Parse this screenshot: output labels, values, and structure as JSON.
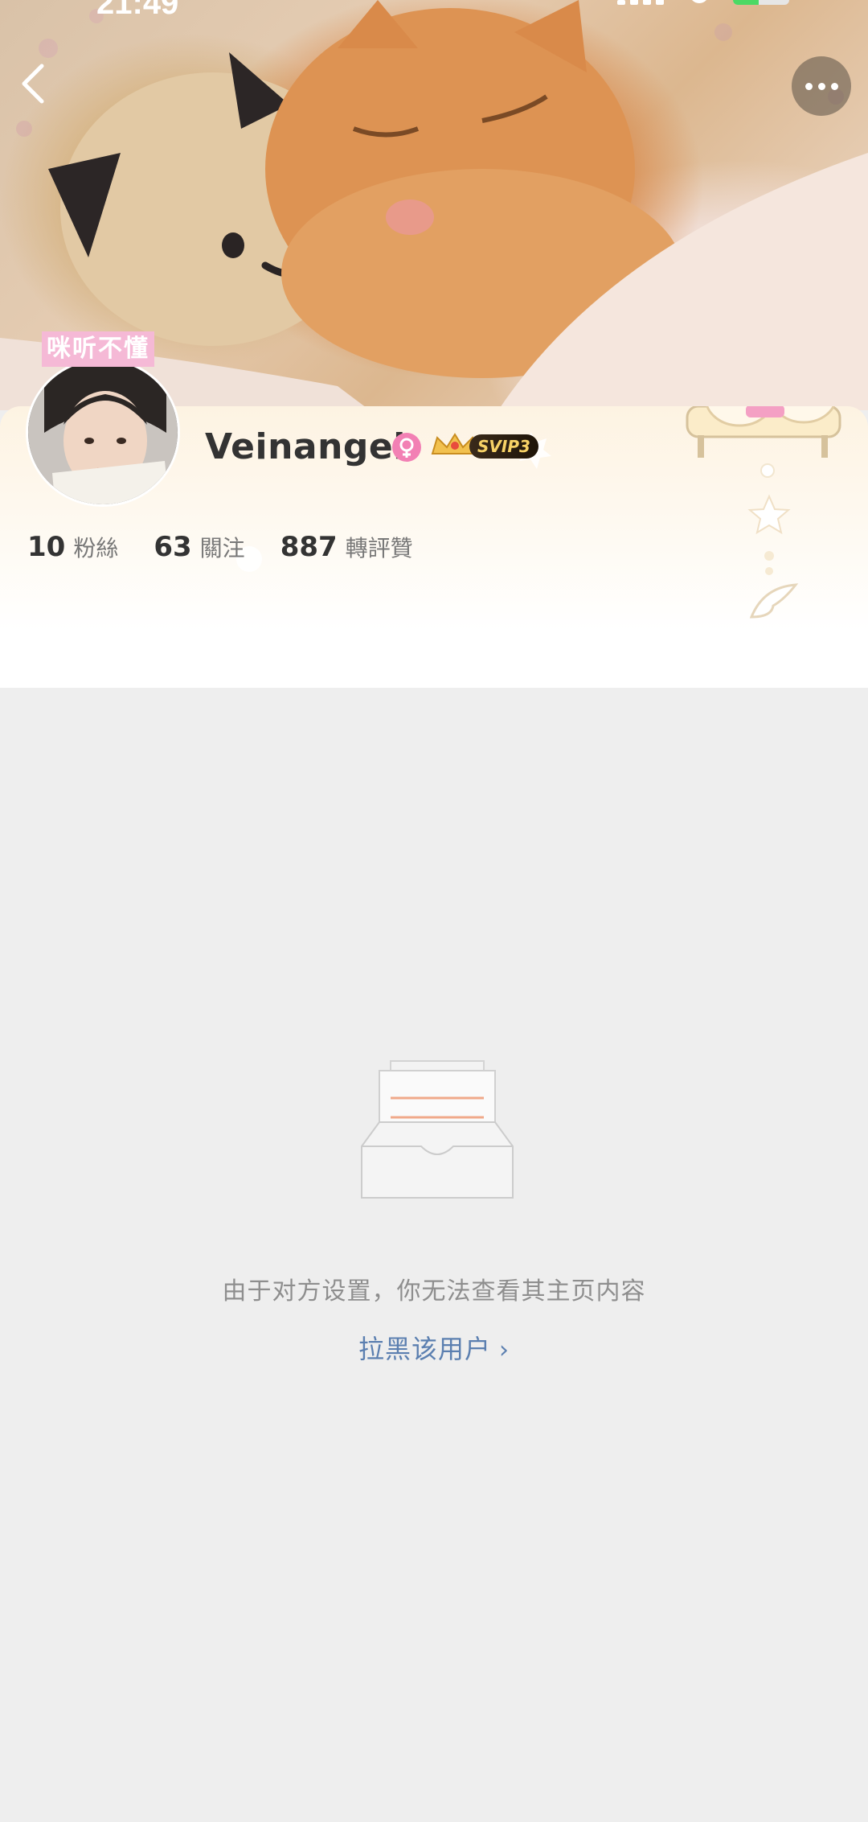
{
  "status_bar": {
    "time": "21:49",
    "battery_level": 0.46
  },
  "header": {
    "back_icon": "chevron-left-icon",
    "more_icon": "ellipsis-icon"
  },
  "profile": {
    "avatar_tag": "咪听不懂",
    "username": "Veinangel",
    "gender_icon": "female-icon",
    "vip_label": "SVIP3",
    "stats": [
      {
        "value": "10",
        "label": "粉絲"
      },
      {
        "value": "63",
        "label": "關注"
      },
      {
        "value": "887",
        "label": "轉評贊"
      }
    ]
  },
  "empty_state": {
    "icon": "empty-inbox-icon",
    "message": "由于对方设置，你无法查看其主页内容",
    "action_label": "拉黑该用户"
  },
  "colors": {
    "background": "#eeeeee",
    "link": "#5b7fb0",
    "tag_pink": "#f5b9d6",
    "gender_pink": "#f280b4",
    "vip_gold": "#f7d266"
  }
}
